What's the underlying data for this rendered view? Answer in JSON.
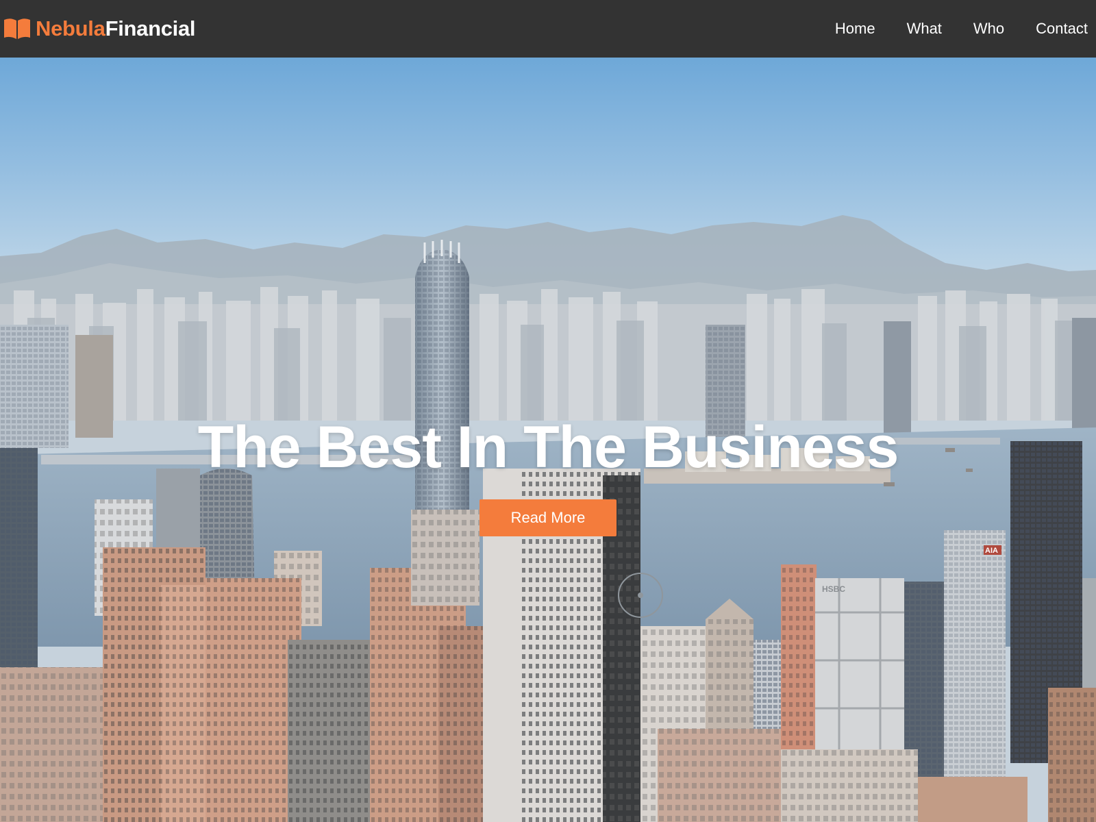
{
  "brand": {
    "name_accent": "Nebula",
    "name_main": "Financial",
    "icon": "open-book-icon",
    "accent_color": "#f47c3c"
  },
  "nav": {
    "links": [
      {
        "label": "Home"
      },
      {
        "label": "What"
      },
      {
        "label": "Who"
      },
      {
        "label": "Contact"
      }
    ],
    "background_color": "#333333"
  },
  "hero": {
    "title": "The Best In The Business",
    "cta_label": "Read More",
    "cta_color": "#f47c3c",
    "background_image": "city-skyline-harbor-photo",
    "signage": [
      "AIA",
      "HSBC"
    ]
  }
}
